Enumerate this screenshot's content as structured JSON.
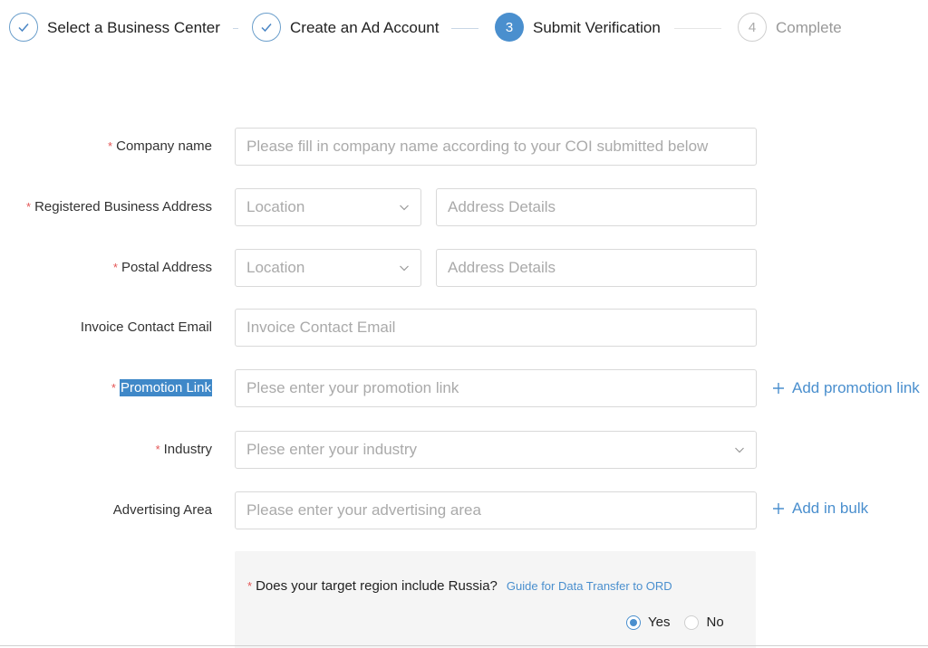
{
  "stepper": {
    "steps": [
      {
        "label": "Select a Business Center",
        "state": "done",
        "icon": "check-icon"
      },
      {
        "label": "Create an Ad Account",
        "state": "done",
        "icon": "check-icon"
      },
      {
        "label": "Submit Verification",
        "state": "active",
        "number": "3"
      },
      {
        "label": "Complete",
        "state": "pending",
        "number": "4"
      }
    ]
  },
  "form": {
    "company_name": {
      "label": "Company name",
      "required": "*",
      "placeholder": "Please fill in company name according to your COI submitted below"
    },
    "registered_address": {
      "label": "Registered Business Address",
      "required": "*",
      "location_placeholder": "Location",
      "details_placeholder": "Address Details"
    },
    "postal_address": {
      "label": "Postal Address",
      "required": "*",
      "location_placeholder": "Location",
      "details_placeholder": "Address Details"
    },
    "invoice_email": {
      "label": "Invoice Contact Email",
      "placeholder": "Invoice Contact Email"
    },
    "promotion_link": {
      "label": "Promotion Link",
      "required": "*",
      "placeholder": "Plese enter your promotion link",
      "add_label": "Add promotion link"
    },
    "industry": {
      "label": "Industry",
      "required": "*",
      "placeholder": "Plese enter your industry"
    },
    "advertising_area": {
      "label": "Advertising Area",
      "placeholder": "Please enter your advertising area",
      "add_label": "Add in bulk"
    },
    "russia": {
      "required": "*",
      "question": "Does your target region include Russia?",
      "guide_link": "Guide for Data Transfer to ORD",
      "options": [
        {
          "label": "Yes",
          "checked": true
        },
        {
          "label": "No",
          "checked": false
        }
      ]
    }
  },
  "colors": {
    "accent": "#4a8fce",
    "required": "#e45656",
    "panel_bg": "#f5f5f5"
  }
}
